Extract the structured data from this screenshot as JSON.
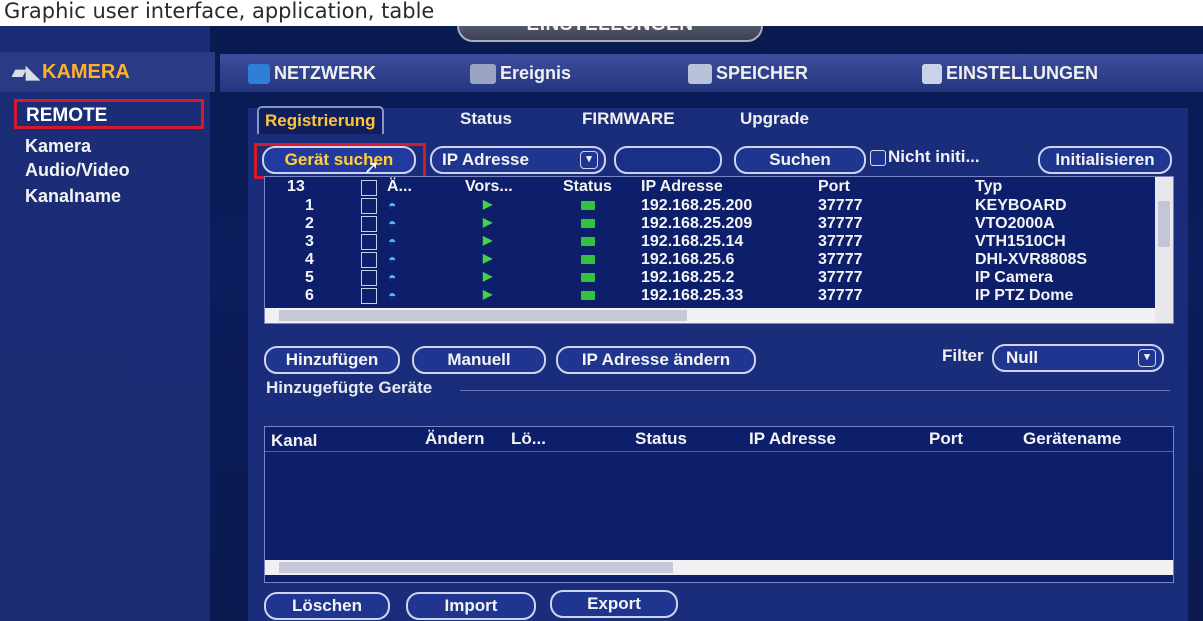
{
  "caption": "Graphic user interface, application, table",
  "title": "EINSTELLUNGEN",
  "sidebar": {
    "header": "KAMERA",
    "items": [
      "REMOTE",
      "Kamera",
      "Audio/Video",
      "Kanalname"
    ]
  },
  "main_tabs": [
    "NETZWERK",
    "Ereignis",
    "SPEICHER",
    "EINSTELLUNGEN"
  ],
  "sub_tabs": [
    "Registrierung",
    "Status",
    "FIRMWARE",
    "Upgrade"
  ],
  "toolbar": {
    "search_device": "Gerät suchen",
    "ip_type": "IP Adresse",
    "search_value": "",
    "search_button": "Suchen",
    "uninit_label": "Nicht initi...",
    "init_button": "Initialisieren"
  },
  "device_list": {
    "count": "13",
    "headers": [
      "Ä...",
      "Vors...",
      "Status",
      "IP Adresse",
      "Port",
      "Typ"
    ],
    "rows": [
      {
        "no": "1",
        "ip": "192.168.25.200",
        "port": "37777",
        "type": "KEYBOARD"
      },
      {
        "no": "2",
        "ip": "192.168.25.209",
        "port": "37777",
        "type": "VTO2000A"
      },
      {
        "no": "3",
        "ip": "192.168.25.14",
        "port": "37777",
        "type": "VTH1510CH"
      },
      {
        "no": "4",
        "ip": "192.168.25.6",
        "port": "37777",
        "type": "DHI-XVR8808S"
      },
      {
        "no": "5",
        "ip": "192.168.25.2",
        "port": "37777",
        "type": "IP Camera"
      },
      {
        "no": "6",
        "ip": "192.168.25.33",
        "port": "37777",
        "type": "IP PTZ Dome"
      }
    ]
  },
  "actions": {
    "add": "Hinzufügen",
    "manual": "Manuell",
    "change_ip": "IP Adresse ändern",
    "filter_label": "Filter",
    "filter_value": "Null"
  },
  "added_devices": {
    "title": "Hinzugefügte Geräte",
    "headers": [
      "Kanal",
      "Ändern",
      "Lö...",
      "Status",
      "IP Adresse",
      "Port",
      "Gerätename"
    ]
  },
  "bottom": {
    "delete": "Löschen",
    "import": "Import",
    "export": "Export"
  }
}
